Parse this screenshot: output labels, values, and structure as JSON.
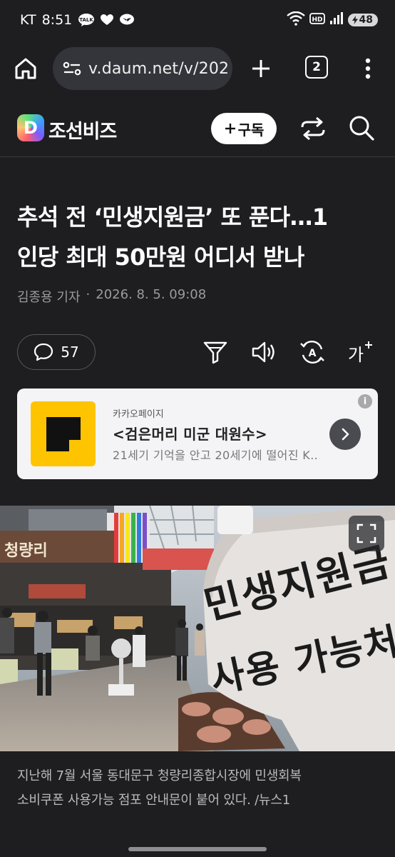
{
  "status_bar": {
    "carrier": "KT",
    "time": "8:51",
    "talk_badge": "TALK",
    "battery": "48"
  },
  "browser": {
    "url": "v.daum.net/v/202",
    "tab_count": "2"
  },
  "site": {
    "name": "조선비즈",
    "logo_letter": "D",
    "subscribe_label": "구독"
  },
  "article": {
    "headline_line1": "추석 전 ‘민생지원금’ 또 푼다…1",
    "headline_line2": "인당 최대 50만원 어디서 받나",
    "author": "김종용 기자",
    "separator": "·",
    "date": "2026. 8. 5. 09:08",
    "comment_count": "57",
    "font_size_label": "가",
    "caption_line1": "지난해 7월 서울 동대문구 청량리종합시장에 민생회복",
    "caption_line2": "소비쿠폰 사용가능 점포 안내문이 붙어 있다. /뉴스1"
  },
  "ad": {
    "source": "카카오페이지",
    "title": "<검은머리 미군 대원수>",
    "description": "21세기 기억을 안고 20세기에 떨어진 K...",
    "info_label": "i"
  },
  "photo": {
    "sign_line1": "민생지원금",
    "sign_line2": "사용 가능처",
    "market_sign": "청량리"
  },
  "icons": {
    "home": "home-icon",
    "site_settings": "site-settings-icon",
    "new_tab": "plus-icon",
    "tabs": "tabs-icon",
    "menu": "more-vert-icon",
    "share": "share-icon",
    "search": "search-icon",
    "comment": "comment-icon",
    "filter": "filter-icon",
    "audio": "speaker-icon",
    "translate": "translate-icon",
    "font_size": "font-size-icon",
    "expand": "expand-icon"
  },
  "colors": {
    "background": "#1e1e21",
    "ad_thumb": "#ffc400"
  }
}
